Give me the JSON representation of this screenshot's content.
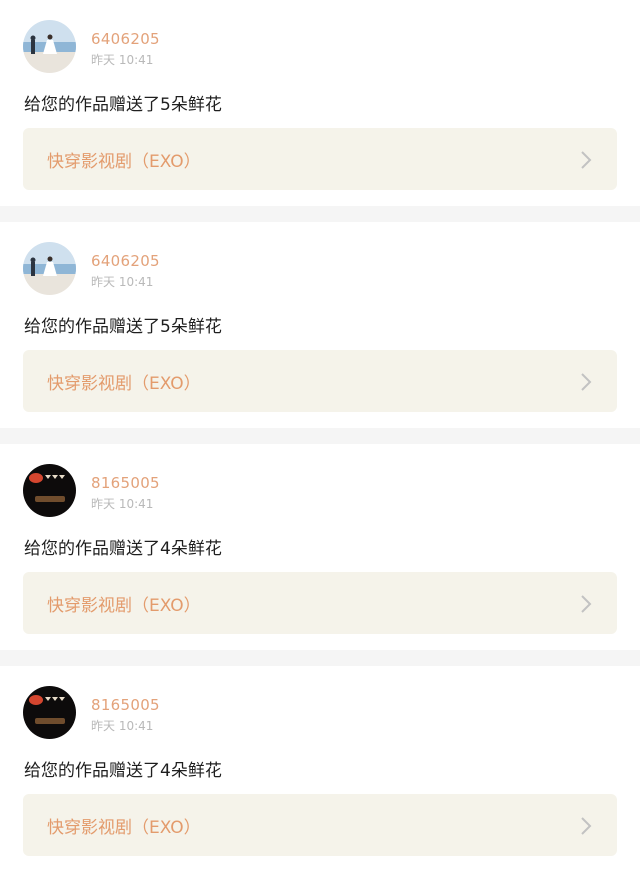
{
  "notifications": [
    {
      "username": "6406205",
      "time": "昨天 10:41",
      "avatar_icon": "beach-couple-avatar",
      "message": "给您的作品赠送了5朵鲜花",
      "work_title": "快穿影视剧（EXO）"
    },
    {
      "username": "6406205",
      "time": "昨天 10:41",
      "avatar_icon": "beach-couple-avatar",
      "message": "给您的作品赠送了5朵鲜花",
      "work_title": "快穿影视剧（EXO）"
    },
    {
      "username": "8165005",
      "time": "昨天 10:41",
      "avatar_icon": "dark-sticker-avatar",
      "message": "给您的作品赠送了4朵鲜花",
      "work_title": "快穿影视剧（EXO）"
    },
    {
      "username": "8165005",
      "time": "昨天 10:41",
      "avatar_icon": "dark-sticker-avatar",
      "message": "给您的作品赠送了4朵鲜花",
      "work_title": "快穿影视剧（EXO）"
    }
  ],
  "colors": {
    "username": "#e3a27a",
    "link_text": "#e39b6c",
    "link_bg": "#f5f3ea",
    "divider": "#f5f5f5"
  }
}
